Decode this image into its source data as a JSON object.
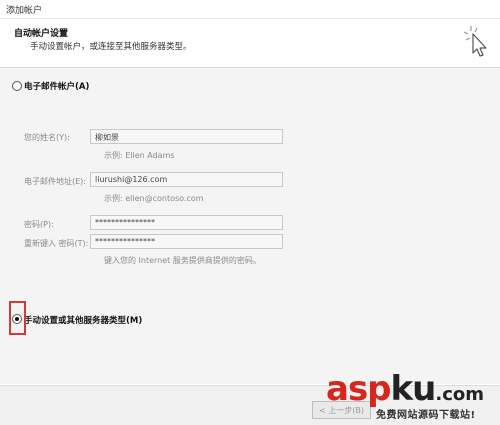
{
  "window": {
    "title": "添加帐户"
  },
  "header": {
    "title": "自动帐户设置",
    "subtitle": "手动设置帐户，或连接至其他服务器类型。"
  },
  "option_auto": {
    "label": "电子邮件帐户(A)"
  },
  "form": {
    "name_label": "您的姓名(Y):",
    "name_value": "柳如景",
    "name_hint": "示例: Ellen Adams",
    "email_label": "电子邮件地址(E):",
    "email_value": "liurushi@126.com",
    "email_hint": "示例: ellen@contoso.com",
    "password_label": "密码(P):",
    "password_value": "***************",
    "retype_label": "重新键入 密码(T):",
    "retype_value": "***************",
    "password_hint": "键入您的 Internet 服务提供商提供的密码。"
  },
  "option_manual": {
    "label": "手动设置或其他服务器类型(M)",
    "selected": true
  },
  "footer": {
    "back_label": "< 上一步(B)"
  },
  "watermark": {
    "brand": "aspku",
    "domain_suffix": ".com",
    "slogan": "免费网站源码下载站!"
  },
  "colors": {
    "highlight": "#d13a3a",
    "brand_red": "#d7261e",
    "brand_dark": "#222222"
  }
}
